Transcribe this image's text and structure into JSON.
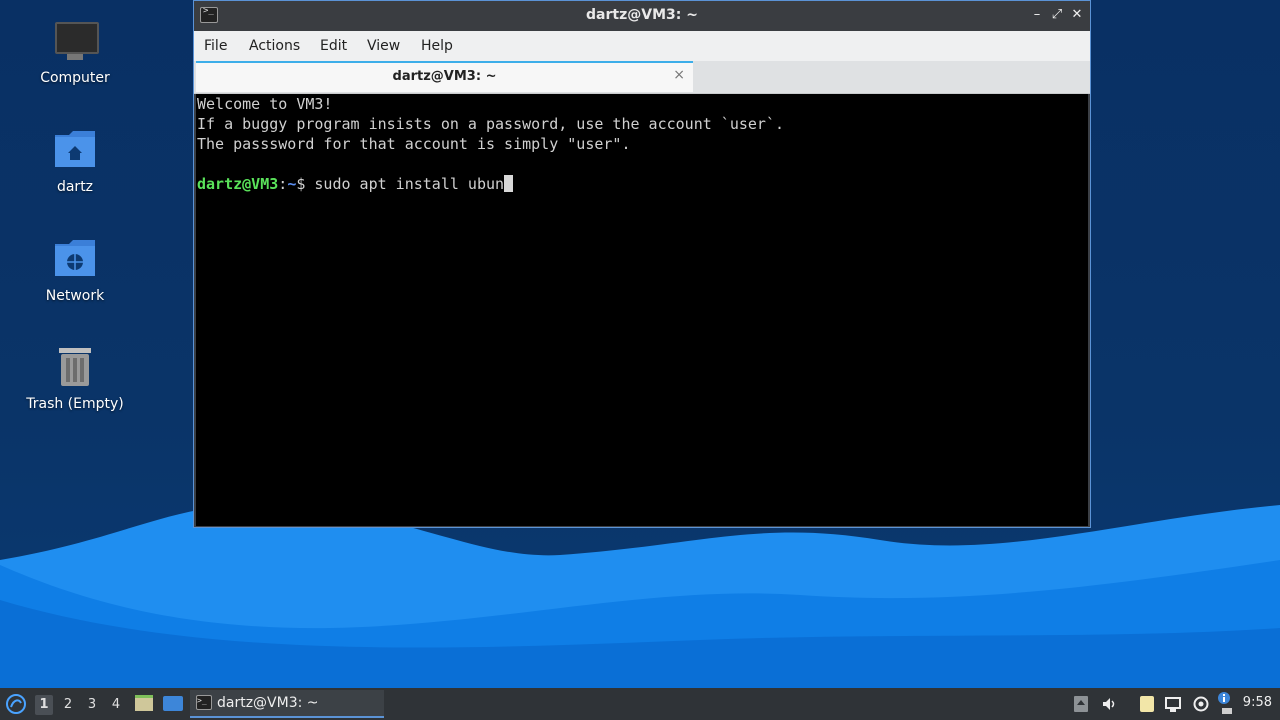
{
  "desktop": {
    "icons": [
      {
        "label": "Computer",
        "icon": "monitor-icon"
      },
      {
        "label": "dartz",
        "icon": "home-folder-icon"
      },
      {
        "label": "Network",
        "icon": "network-folder-icon"
      },
      {
        "label": "Trash (Empty)",
        "icon": "trash-icon"
      }
    ]
  },
  "window": {
    "title": "dartz@VM3: ~",
    "controls": {
      "minimize": "–",
      "maximize": "⤢",
      "close": "✕"
    },
    "menu": [
      "File",
      "Actions",
      "Edit",
      "View",
      "Help"
    ],
    "tab": {
      "label": "dartz@VM3: ~",
      "close": "×"
    },
    "terminal": {
      "lines": [
        "Welcome to VM3!",
        "If a buggy program insists on a password, use the account `user`.",
        "The passsword for that account is simply \"user\"."
      ],
      "prompt_user": "dartz@VM3",
      "prompt_sep": ":",
      "prompt_path": "~",
      "prompt_symbol": "$",
      "command": " sudo apt install ubun"
    }
  },
  "taskbar": {
    "desktops": [
      "1",
      "2",
      "3",
      "4"
    ],
    "active_desktop": "1",
    "task_label": "dartz@VM3: ~",
    "clock": "9:58"
  },
  "colors": {
    "accent": "#5b93d6",
    "prompt_user": "#5ae25a",
    "prompt_path": "#5b8ef0",
    "wave_light": "#1e95ff",
    "wave_mid": "#0b74de"
  }
}
